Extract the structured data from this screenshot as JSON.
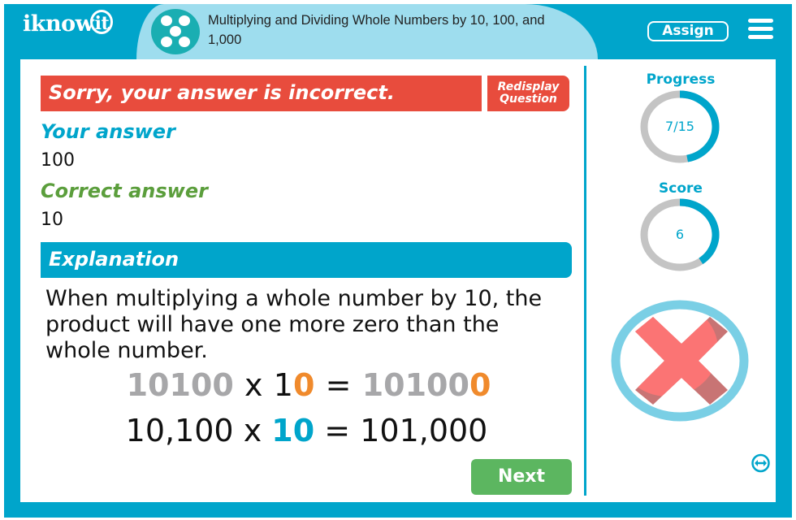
{
  "header": {
    "logo_text": "iknow",
    "logo_bulb_text": "it",
    "topic_icon": "dots-circle-icon",
    "topic_title": "Multiplying and Dividing Whole Numbers by 10, 100, and 1,000",
    "assign_label": "Assign",
    "menu_icon": "hamburger-menu-icon"
  },
  "feedback": {
    "banner_text": "Sorry, your answer is incorrect.",
    "redisplay_label_line1": "Redisplay",
    "redisplay_label_line2": "Question",
    "your_answer_label": "Your answer",
    "your_answer_value": "100",
    "correct_answer_label": "Correct answer",
    "correct_answer_value": "10"
  },
  "explanation": {
    "header": "Explanation",
    "text": "When multiplying a whole number by 10, the product will have one more zero than the whole number.",
    "equation1": {
      "a": "10100",
      "op": "x",
      "b_prefix": "1",
      "b_zero": "0",
      "eq": "=",
      "result_prefix": "10100",
      "result_zero": "0"
    },
    "equation2": {
      "a": "10,100",
      "op": "x",
      "b": "10",
      "eq": "=",
      "result": "101,000"
    }
  },
  "next_label": "Next",
  "sidebar": {
    "progress_label": "Progress",
    "progress_text": "7/15",
    "progress_fraction": 0.4667,
    "score_label": "Score",
    "score_text": "6",
    "score_fraction": 0.4,
    "result_icon": "incorrect-x-icon",
    "resize_icon": "horizontal-resize-icon"
  },
  "colors": {
    "brand": "#00A5CB",
    "header_pill": "#9EDDEE",
    "incorrect": "#E84C3D",
    "correct_label": "#5B9E3C",
    "next_button": "#5CB660",
    "highlight_orange": "#F08A2C",
    "muted_gray": "#A7A7A9",
    "ring_track": "#C4C4C4"
  }
}
